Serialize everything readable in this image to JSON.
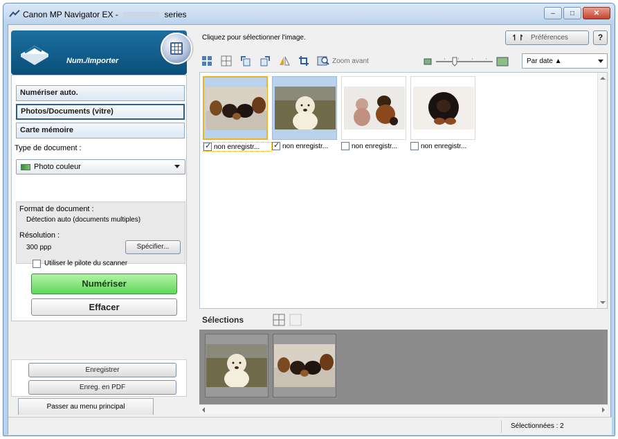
{
  "window": {
    "title_prefix": "Canon MP Navigator EX -",
    "title_suffix": "series",
    "controls": {
      "minimize": "–",
      "maximize": "□",
      "close": "✕"
    }
  },
  "left_panel": {
    "header_label": "Num./Importer",
    "nav": [
      {
        "label": "Numériser auto.",
        "active": false
      },
      {
        "label": "Photos/Documents (vitre)",
        "active": true
      },
      {
        "label": "Carte mémoire",
        "active": false
      }
    ],
    "doc_type_label": "Type de document :",
    "doc_type_value": "Photo couleur",
    "format_label": "Format de document :",
    "format_value": "Détection auto (documents multiples)",
    "resolution_label": "Résolution :",
    "resolution_value": "300 ppp",
    "specify_button": "Spécifier...",
    "scanner_driver_label": "Utiliser le pilote du scanner",
    "scan_button": "Numériser",
    "clear_button": "Effacer",
    "save_button": "Enregistrer",
    "save_pdf_button": "Enreg. en PDF",
    "main_menu_button": "Passer au menu principal"
  },
  "right_panel": {
    "hint": "Cliquez pour sélectionner l'image.",
    "preferences_button": "Préférences",
    "help_button": "?",
    "zoom_label": "Zoom avant",
    "sort_value": "Par date ▲",
    "thumbnails": [
      {
        "caption": "non enregistr...",
        "checked": true,
        "selected": true,
        "focused": true
      },
      {
        "caption": "non enregistr...",
        "checked": true,
        "selected": true,
        "focused": false
      },
      {
        "caption": "non enregistr...",
        "checked": false,
        "selected": false,
        "focused": false
      },
      {
        "caption": "non enregistr...",
        "checked": false,
        "selected": false,
        "focused": false
      }
    ],
    "selections_title": "Sélections"
  },
  "statusbar": {
    "selected_text": "Sélectionnées : 2"
  },
  "colors": {
    "header_blue": "#0a4f7a",
    "scan_green": "#5ed85a",
    "focus_orange": "#f0b21e",
    "selection_blue": "#b9d3ee",
    "strip_gray": "#8c8c8c"
  }
}
